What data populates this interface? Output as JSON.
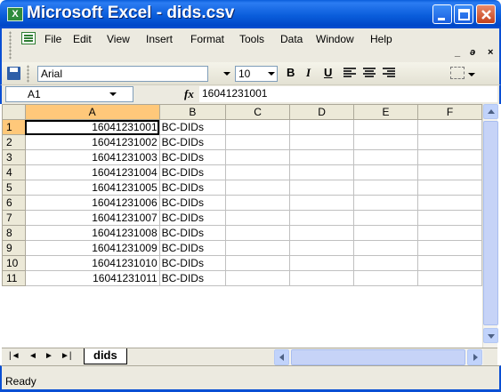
{
  "window": {
    "app_icon": "excel-icon",
    "title": "Microsoft Excel - dids.csv",
    "controls": {
      "minimize": "minimize-icon",
      "maximize": "maximize-icon",
      "close": "close-icon"
    }
  },
  "menubar": {
    "items": [
      "File",
      "Edit",
      "View",
      "Insert",
      "Format",
      "Tools",
      "Data",
      "Window",
      "Help"
    ],
    "doc_minimize": "_",
    "doc_restore": "ǝ",
    "doc_close": "×"
  },
  "toolbar": {
    "font": "Arial",
    "size": "10",
    "bold": "B",
    "italic": "I",
    "underline": "U"
  },
  "formula_bar": {
    "name_box": "A1",
    "fx": "fx",
    "value": "16041231001"
  },
  "sheet": {
    "columns": [
      "A",
      "B",
      "C",
      "D",
      "E",
      "F"
    ],
    "rows": [
      {
        "num": "1",
        "a": "16041231001",
        "b": "BC-DIDs"
      },
      {
        "num": "2",
        "a": "16041231002",
        "b": "BC-DIDs"
      },
      {
        "num": "3",
        "a": "16041231003",
        "b": "BC-DIDs"
      },
      {
        "num": "4",
        "a": "16041231004",
        "b": "BC-DIDs"
      },
      {
        "num": "5",
        "a": "16041231005",
        "b": "BC-DIDs"
      },
      {
        "num": "6",
        "a": "16041231006",
        "b": "BC-DIDs"
      },
      {
        "num": "7",
        "a": "16041231007",
        "b": "BC-DIDs"
      },
      {
        "num": "8",
        "a": "16041231008",
        "b": "BC-DIDs"
      },
      {
        "num": "9",
        "a": "16041231009",
        "b": "BC-DIDs"
      },
      {
        "num": "10",
        "a": "16041231010",
        "b": "BC-DIDs"
      },
      {
        "num": "11",
        "a": "16041231011",
        "b": "BC-DIDs"
      }
    ]
  },
  "tabs": {
    "active": "dids"
  },
  "status": {
    "text": "Ready"
  }
}
